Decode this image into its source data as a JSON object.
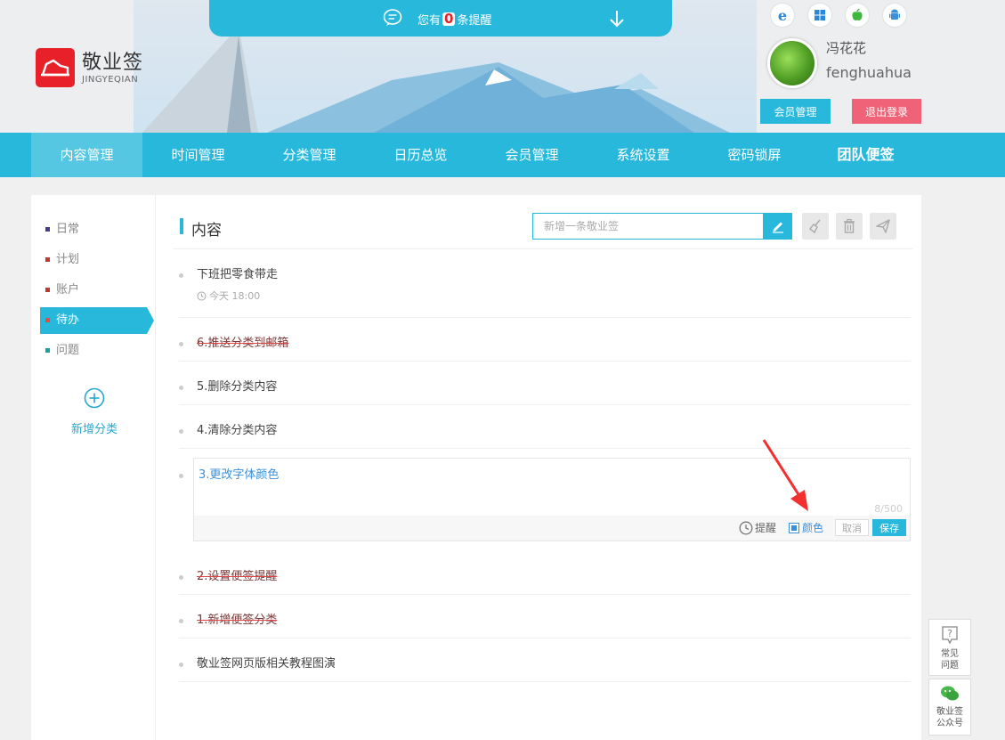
{
  "header": {
    "reminder_prefix": "您有",
    "reminder_count": "0",
    "reminder_suffix": "条提醒",
    "logo_cn": "敬业签",
    "logo_en": "JINGYEQIAN",
    "user_name": "冯花花",
    "user_id": "fenghuahua",
    "member_btn": "会员管理",
    "logout_btn": "退出登录",
    "os_icons": [
      "ie-icon",
      "windows-icon",
      "apple-icon",
      "android-icon"
    ]
  },
  "nav": {
    "items": [
      "内容管理",
      "时间管理",
      "分类管理",
      "日历总览",
      "会员管理",
      "系统设置",
      "密码锁屏",
      "团队便签"
    ],
    "active": "内容管理"
  },
  "sidebar": {
    "categories": [
      {
        "label": "日常",
        "color": "#4a3a8c"
      },
      {
        "label": "计划",
        "color": "#c0392b"
      },
      {
        "label": "账户",
        "color": "#c0392b"
      },
      {
        "label": "待办",
        "color": "#e74c3c"
      },
      {
        "label": "问题",
        "color": "#17a2a2"
      }
    ],
    "active": "待办",
    "add_label": "新增分类"
  },
  "content": {
    "title": "内容",
    "new_placeholder": "新增一条敬业签",
    "notes": [
      {
        "text": "下班把零食带走",
        "time": "今天 18:00",
        "done": false
      },
      {
        "text": "6.推送分类到邮箱",
        "done": true
      },
      {
        "text": "5.删除分类内容",
        "done": false
      },
      {
        "text": "4.清除分类内容",
        "done": false
      },
      {
        "text": "2.设置便签提醒",
        "done": true
      },
      {
        "text": "1.新增便签分类",
        "done": true
      },
      {
        "text": "敬业签网页版相关教程图演",
        "done": false
      }
    ],
    "editor": {
      "text": "3.更改字体颜色",
      "count": "8/500",
      "remind": "提醒",
      "color": "颜色",
      "cancel": "取消",
      "save": "保存"
    }
  },
  "float": {
    "faq": "常见\n问题",
    "faq_line1": "常见",
    "faq_line2": "问题",
    "wechat_line1": "敬业签",
    "wechat_line2": "公众号"
  },
  "colors": {
    "accent": "#27b8dc",
    "logout": "#f06277",
    "brand_red": "#e8202a"
  }
}
